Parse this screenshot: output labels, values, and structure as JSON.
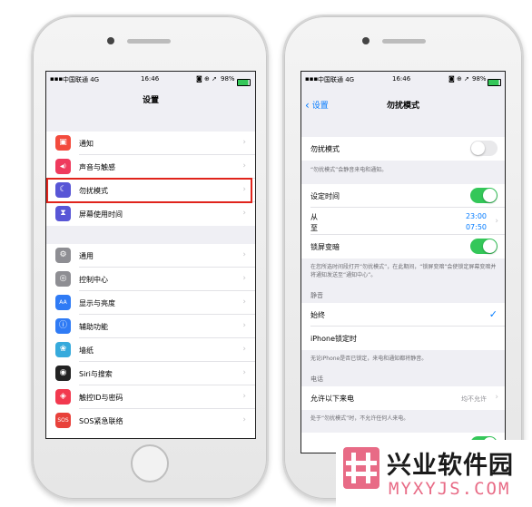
{
  "left_phone": {
    "status": {
      "carrier": "中国联通 4G",
      "time": "16:46",
      "battery": "98%"
    },
    "title": "设置",
    "group1": [
      {
        "label": "通知",
        "icon": "notifications-icon",
        "color": "#f34b3d"
      },
      {
        "label": "声音与触感",
        "icon": "sound-icon",
        "color": "#ef3a5d"
      },
      {
        "label": "勿扰模式",
        "icon": "moon-icon",
        "color": "#5856d6"
      },
      {
        "label": "屏幕使用时间",
        "icon": "hourglass-icon",
        "color": "#5856d6"
      }
    ],
    "group2": [
      {
        "label": "通用",
        "icon": "gear-icon",
        "color": "#8e8e93"
      },
      {
        "label": "控制中心",
        "icon": "control-center-icon",
        "color": "#8e8e93"
      },
      {
        "label": "显示与亮度",
        "icon": "display-icon",
        "color": "#2f7bf5"
      },
      {
        "label": "辅助功能",
        "icon": "accessibility-icon",
        "color": "#2f7bf5"
      },
      {
        "label": "墙纸",
        "icon": "wallpaper-icon",
        "color": "#36aadc"
      },
      {
        "label": "Siri与搜索",
        "icon": "siri-icon",
        "color": "#222222"
      },
      {
        "label": "触控ID与密码",
        "icon": "fingerprint-icon",
        "color": "#f2394f"
      },
      {
        "label": "SOS紧急联络",
        "icon": "sos-icon",
        "color": "#e8413b"
      }
    ],
    "icon_glyphs": [
      "▣",
      "◀)",
      "☾",
      "⧗",
      "⚙",
      "◎",
      "AA",
      "ⓘ",
      "❀",
      "◉",
      "◈",
      "SOS"
    ]
  },
  "right_phone": {
    "status": {
      "carrier": "中国联通 4G",
      "time": "16:46",
      "battery": "98%"
    },
    "back_label": "设置",
    "title": "勿扰模式",
    "dnd_label": "勿扰模式",
    "dnd_on": false,
    "dnd_note": "“勿扰模式”会静音来电和通知。",
    "scheduled_label": "设定时间",
    "scheduled_on": true,
    "from_label": "从",
    "to_label": "至",
    "from_time": "23:00",
    "to_time": "07:50",
    "bedtime_label": "锁屏变暗",
    "bedtime_on": true,
    "bedtime_note": "在您所选时间段打开“勿扰模式”，在此期间，“锁屏变暗”会使锁定屏幕变暗并将通知发送至“通知中心”。",
    "silence_header": "静音",
    "always_label": "始终",
    "locked_label": "iPhone锁定时",
    "silence_note": "无论iPhone是否已锁定，来电和通知都将静音。",
    "phone_header": "电话",
    "allow_calls_label": "允许以下来电",
    "allow_calls_value": "均不允许",
    "allow_calls_note": "处于“勿扰模式”时，不允许任何人来电。"
  },
  "watermark": {
    "cn": "兴业软件园",
    "url": "MYXYJS.COM"
  },
  "colors": {
    "accent": "#007aff",
    "toggle_on": "#34c759",
    "highlight": "#e0241c"
  }
}
